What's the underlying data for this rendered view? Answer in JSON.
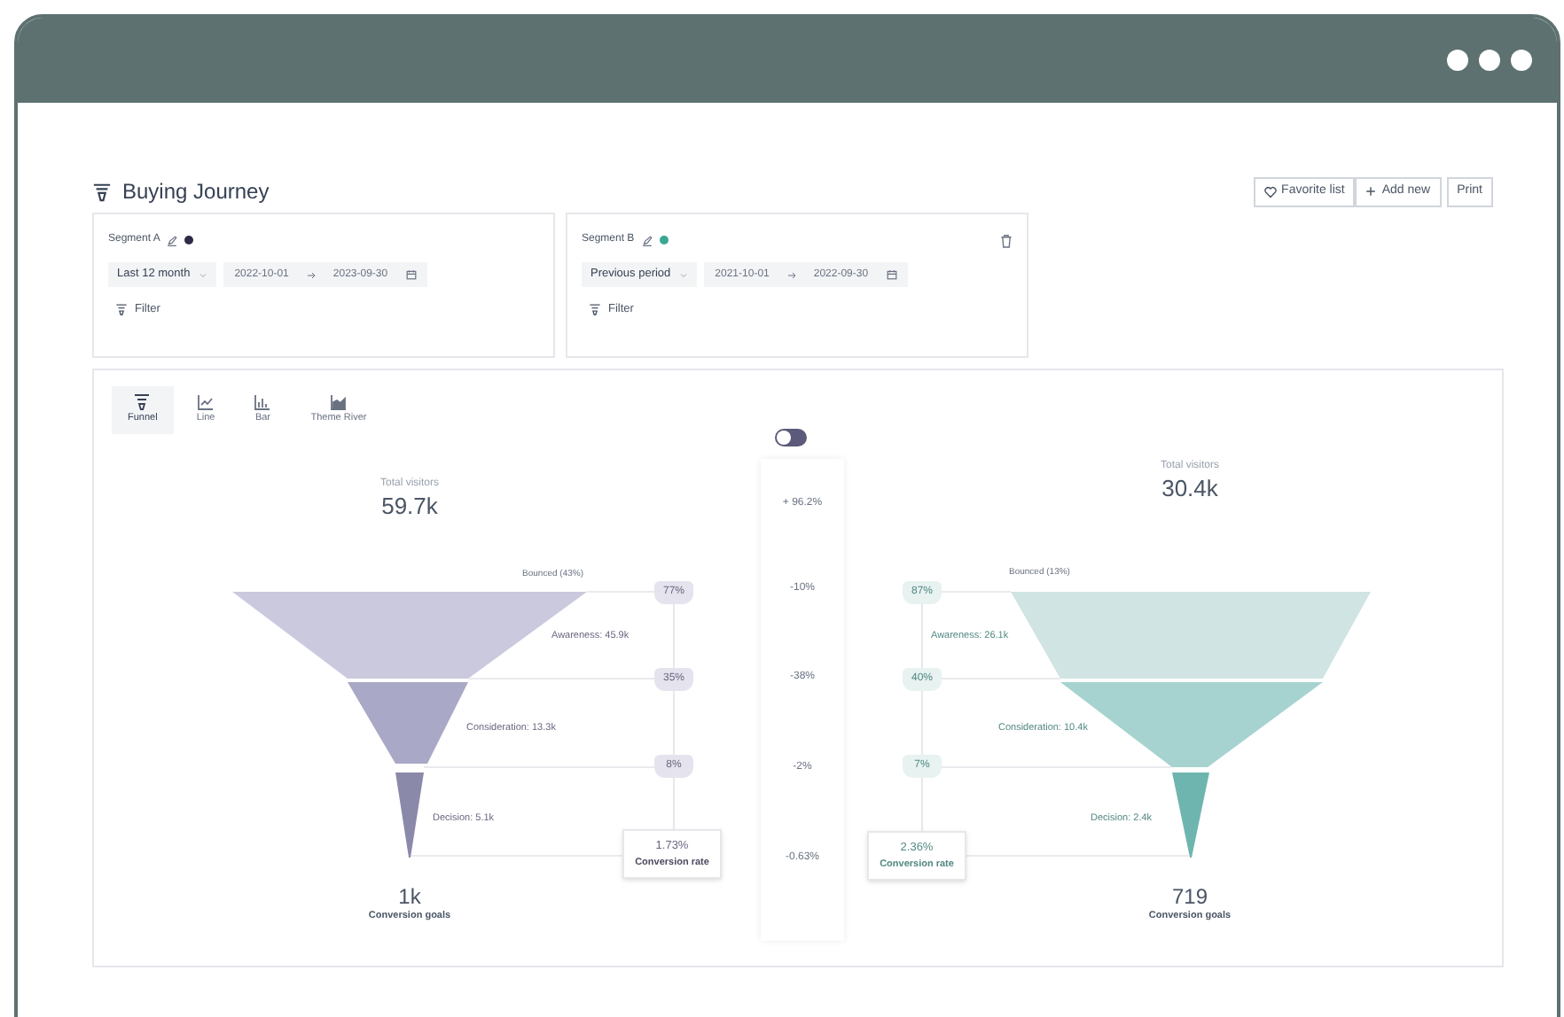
{
  "title": "Buying Journey",
  "actions": [
    {
      "kind": "favorite",
      "label": "Favorite list"
    },
    {
      "kind": "add",
      "label": "Add new"
    },
    {
      "kind": "plain",
      "label": "Print"
    }
  ],
  "segments": [
    {
      "label": "Segment A",
      "color": "#2d2a4a",
      "period": "Last 12 month",
      "date_from": "2022-10-01",
      "date_to": "2023-09-30",
      "filter": "Filter",
      "removable": false
    },
    {
      "label": "Segment B",
      "color": "#3aa890",
      "period": "Previous period",
      "date_from": "2021-10-01",
      "date_to": "2022-09-30",
      "filter": "Filter",
      "removable": true
    }
  ],
  "chart_types": [
    {
      "kind": "funnel",
      "label": "Funnel",
      "selected": true
    },
    {
      "kind": "line",
      "label": "Line",
      "selected": false
    },
    {
      "kind": "bar",
      "label": "Bar",
      "selected": false
    },
    {
      "kind": "river",
      "label": "Theme River",
      "selected": false
    }
  ],
  "compare_toggle": {
    "on": false
  },
  "deltas": [
    "+ 96.2%",
    "-10%",
    "-38%",
    "-2%",
    "-0.63%"
  ],
  "funnels": [
    {
      "total_label": "Total visitors",
      "total": "59.7k",
      "bounced": "Bounced (43%)",
      "stages": [
        {
          "label": "Awareness: 45.9k",
          "rate": "77%",
          "color": "#cac9dd"
        },
        {
          "label": "Consideration: 13.3k",
          "rate": "35%",
          "color": "#a9a8c6"
        },
        {
          "label": "Decision: 5.1k",
          "rate": "8%",
          "color": "#8b89aa"
        }
      ],
      "conversion_rate": "1.73%",
      "conversion_label": "Conversion rate",
      "goals": "1k",
      "goals_label": "Conversion goals"
    },
    {
      "total_label": "Total visitors",
      "total": "30.4k",
      "bounced": "Bounced (13%)",
      "stages": [
        {
          "label": "Awareness: 26.1k",
          "rate": "87%",
          "color": "#cfe4e3"
        },
        {
          "label": "Consideration: 10.4k",
          "rate": "40%",
          "color": "#a6d3cf"
        },
        {
          "label": "Decision: 2.4k",
          "rate": "7%",
          "color": "#6fb5af"
        }
      ],
      "conversion_rate": "2.36%",
      "conversion_label": "Conversion rate",
      "goals": "719",
      "goals_label": "Conversion goals"
    }
  ]
}
